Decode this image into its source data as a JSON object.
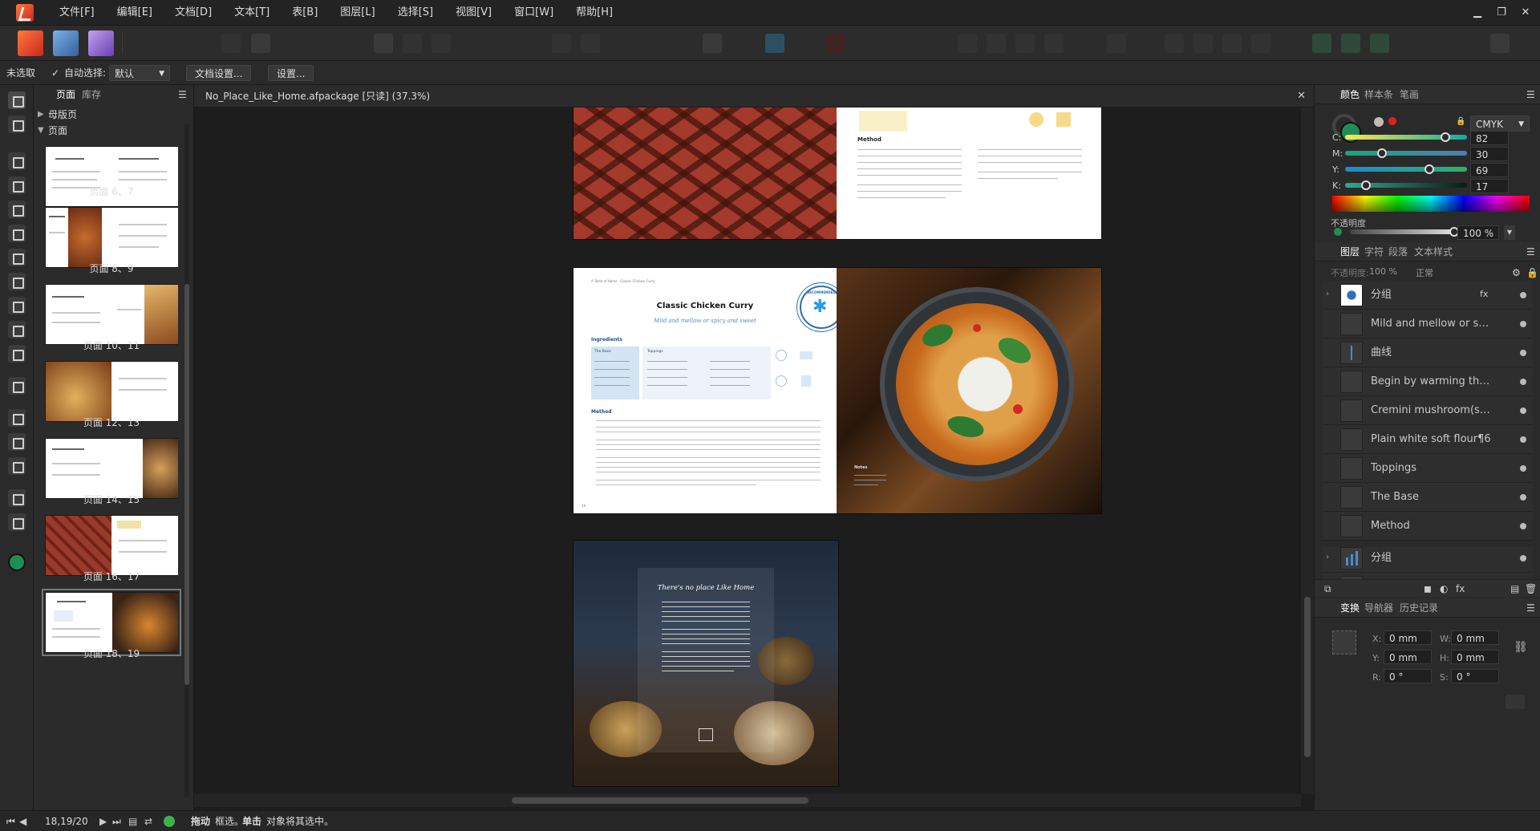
{
  "menu": {
    "items": [
      "文件[F]",
      "编辑[E]",
      "文档[D]",
      "文本[T]",
      "表[B]",
      "图层[L]",
      "选择[S]",
      "视图[V]",
      "窗口[W]",
      "帮助[H]"
    ],
    "window_controls": [
      "▁",
      "❐",
      "✕"
    ]
  },
  "context_bar": {
    "selection_status": "未选取",
    "auto_select_label": "自动选择:",
    "auto_select_value": "默认",
    "doc_setup_button": "文档设置...",
    "preferences_button": "设置..."
  },
  "pages_panel": {
    "tabs": [
      "页面",
      "库存"
    ],
    "master_pages_label": "母版页",
    "pages_label": "页面",
    "spreads": [
      {
        "label": "页面 6、7"
      },
      {
        "label": "页面 8、9"
      },
      {
        "label": "页面 10、11"
      },
      {
        "label": "页面 12、13"
      },
      {
        "label": "页面 14、15"
      },
      {
        "label": "页面 16、17"
      },
      {
        "label": "页面 18、19",
        "selected": true
      }
    ]
  },
  "document": {
    "tab_title": "No_Place_Like_Home.afpackage [只读] (37.3%)",
    "spread1": {
      "method_heading": "Method"
    },
    "spread2": {
      "running_head": "A Taste of Home · Classic Chicken Curry",
      "title": "Classic Chicken Curry",
      "subtitle": "Mild and mellow or spicy and sweet",
      "ingredients_heading": "Ingredients",
      "base_heading": "The Base",
      "toppings_heading": "Toppings",
      "method_heading": "Method",
      "badge_text": "RECOMMENDED",
      "notes_heading": "Notes",
      "page_left": "18"
    },
    "spread3": {
      "title": "There's no place Like Home"
    }
  },
  "color_panel": {
    "tabs": [
      "颜色",
      "样本条",
      "笔画"
    ],
    "model": "CMYK",
    "channels": [
      {
        "label": "C:",
        "value": "82",
        "fraction": 0.82,
        "track": "linear-gradient(90deg,#ffe94a,#10a9a0)"
      },
      {
        "label": "M:",
        "value": "30",
        "fraction": 0.3,
        "track": "linear-gradient(90deg,#17a77a,#4f7fb5)"
      },
      {
        "label": "Y:",
        "value": "69",
        "fraction": 0.69,
        "track": "linear-gradient(90deg,#1a8bd1,#2bb36a)"
      },
      {
        "label": "K:",
        "value": "17",
        "fraction": 0.17,
        "track": "linear-gradient(90deg,#2faa8e,#0b1a16)"
      }
    ],
    "opacity_label": "不透明度",
    "opacity_value": "100 %",
    "current_color": "#1f8d55"
  },
  "layers_panel": {
    "tabs": [
      "图层",
      "字符",
      "段落",
      "文本样式"
    ],
    "opacity_label": "不透明度:",
    "opacity_value": "100 %",
    "blend_mode": "正常",
    "layers": [
      {
        "name": "分组",
        "expand": "›"
      },
      {
        "name": "Mild and mellow or spicy",
        "expand": ""
      },
      {
        "name": "曲线",
        "expand": ""
      },
      {
        "name": "Begin by warming the fl...",
        "expand": ""
      },
      {
        "name": "Cremini mushroom(s)¶...",
        "expand": ""
      },
      {
        "name": "Plain white soft flour¶6",
        "expand": ""
      },
      {
        "name": "Toppings",
        "expand": ""
      },
      {
        "name": "The Base",
        "expand": ""
      },
      {
        "name": "Method",
        "expand": ""
      },
      {
        "name": "分组",
        "expand": "›"
      },
      {
        "name": "分组",
        "expand": "›"
      }
    ]
  },
  "transform_panel": {
    "tabs": [
      "变换",
      "导航器",
      "历史记录"
    ],
    "x_label": "X:",
    "x_value": "0 mm",
    "y_label": "Y:",
    "y_value": "0 mm",
    "w_label": "W:",
    "w_value": "0 mm",
    "h_label": "H:",
    "h_value": "0 mm",
    "r_label": "R:",
    "r_value": "0 °",
    "s_label": "S:",
    "s_value": "0 °"
  },
  "status_bar": {
    "page_indicator": "18,19/20",
    "hint_drag": "拖动",
    "hint_drag_text": "框选。",
    "hint_click": "单击",
    "hint_click_text": "对象将其选中。"
  }
}
